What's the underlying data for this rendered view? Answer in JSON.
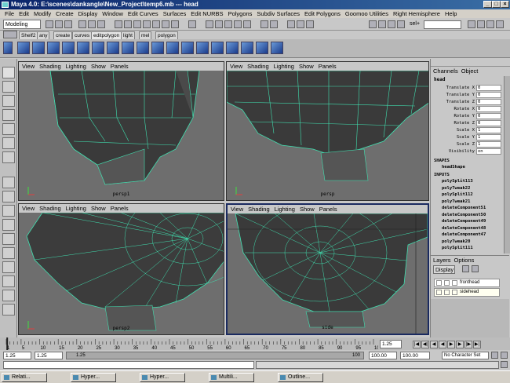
{
  "window": {
    "title": "Maya 4.0: E:\\scenes\\dankangle\\New_Project\\temp6.mb   ---   head"
  },
  "menubar": [
    "File",
    "Edit",
    "Modify",
    "Create",
    "Display",
    "Window",
    "Edit Curves",
    "Surfaces",
    "Edit NURBS",
    "Polygons",
    "Subdiv Surfaces",
    "Edit Polygons",
    "Goomoo Utilities",
    "Right Hemisphere",
    "Help"
  ],
  "statusline": {
    "mode": "Modeling",
    "sel_label": "sel+"
  },
  "shelf_tabs": [
    "Shelf2",
    "any",
    "create",
    "curves",
    "editpolygon",
    "light",
    "mel",
    "polygon"
  ],
  "viewports": [
    {
      "menu": [
        "View",
        "Shading",
        "Lighting",
        "Show",
        "Panels"
      ],
      "camera": "persp1"
    },
    {
      "menu": [
        "View",
        "Shading",
        "Lighting",
        "Show",
        "Panels"
      ],
      "camera": "persp"
    },
    {
      "menu": [
        "View",
        "Shading",
        "Lighting",
        "Show",
        "Panels"
      ],
      "camera": "persp2"
    },
    {
      "menu": [
        "View",
        "Shading",
        "Lighting",
        "Show",
        "Panels"
      ],
      "camera": "side"
    }
  ],
  "channelbox": {
    "menu": [
      "Channels",
      "Object"
    ],
    "object": "head",
    "attributes": [
      {
        "name": "Translate X",
        "value": "0"
      },
      {
        "name": "Translate Y",
        "value": "0"
      },
      {
        "name": "Translate Z",
        "value": "0"
      },
      {
        "name": "Rotate X",
        "value": "0"
      },
      {
        "name": "Rotate Y",
        "value": "0"
      },
      {
        "name": "Rotate Z",
        "value": "0"
      },
      {
        "name": "Scale X",
        "value": "1"
      },
      {
        "name": "Scale Y",
        "value": "1"
      },
      {
        "name": "Scale Z",
        "value": "1"
      },
      {
        "name": "Visibility",
        "value": "on"
      }
    ],
    "shapes_header": "SHAPES",
    "shape": "headShape",
    "inputs_header": "INPUTS",
    "inputs": [
      "polySplit113",
      "polyTweak22",
      "polySplit112",
      "polyTweak21",
      "deleteComponent51",
      "deleteComponent50",
      "deleteComponent49",
      "deleteComponent48",
      "deleteComponent47",
      "polyTweak20",
      "polySplit111"
    ]
  },
  "layers": {
    "menu": [
      "Layers",
      "Options"
    ],
    "display_option": "Display",
    "items": [
      "fronthead",
      "sidehead"
    ]
  },
  "timeslider": {
    "ticks": [
      "1",
      "5",
      "10",
      "15",
      "20",
      "25",
      "30",
      "35",
      "40",
      "45",
      "50",
      "55",
      "60",
      "65",
      "70",
      "75",
      "80",
      "85",
      "90",
      "95",
      "100"
    ],
    "current_frame": "1.25",
    "start_label": "1.25"
  },
  "range": {
    "start": "1.25",
    "start2": "1.25",
    "end1": "100.00",
    "end2": "100.00",
    "inner_label": "1.25",
    "inner_end": "100",
    "character_set": "No Character Set"
  },
  "taskbar": [
    "Relati...",
    "Hyper...",
    "Hyper...",
    "Multili...",
    "Outline..."
  ]
}
